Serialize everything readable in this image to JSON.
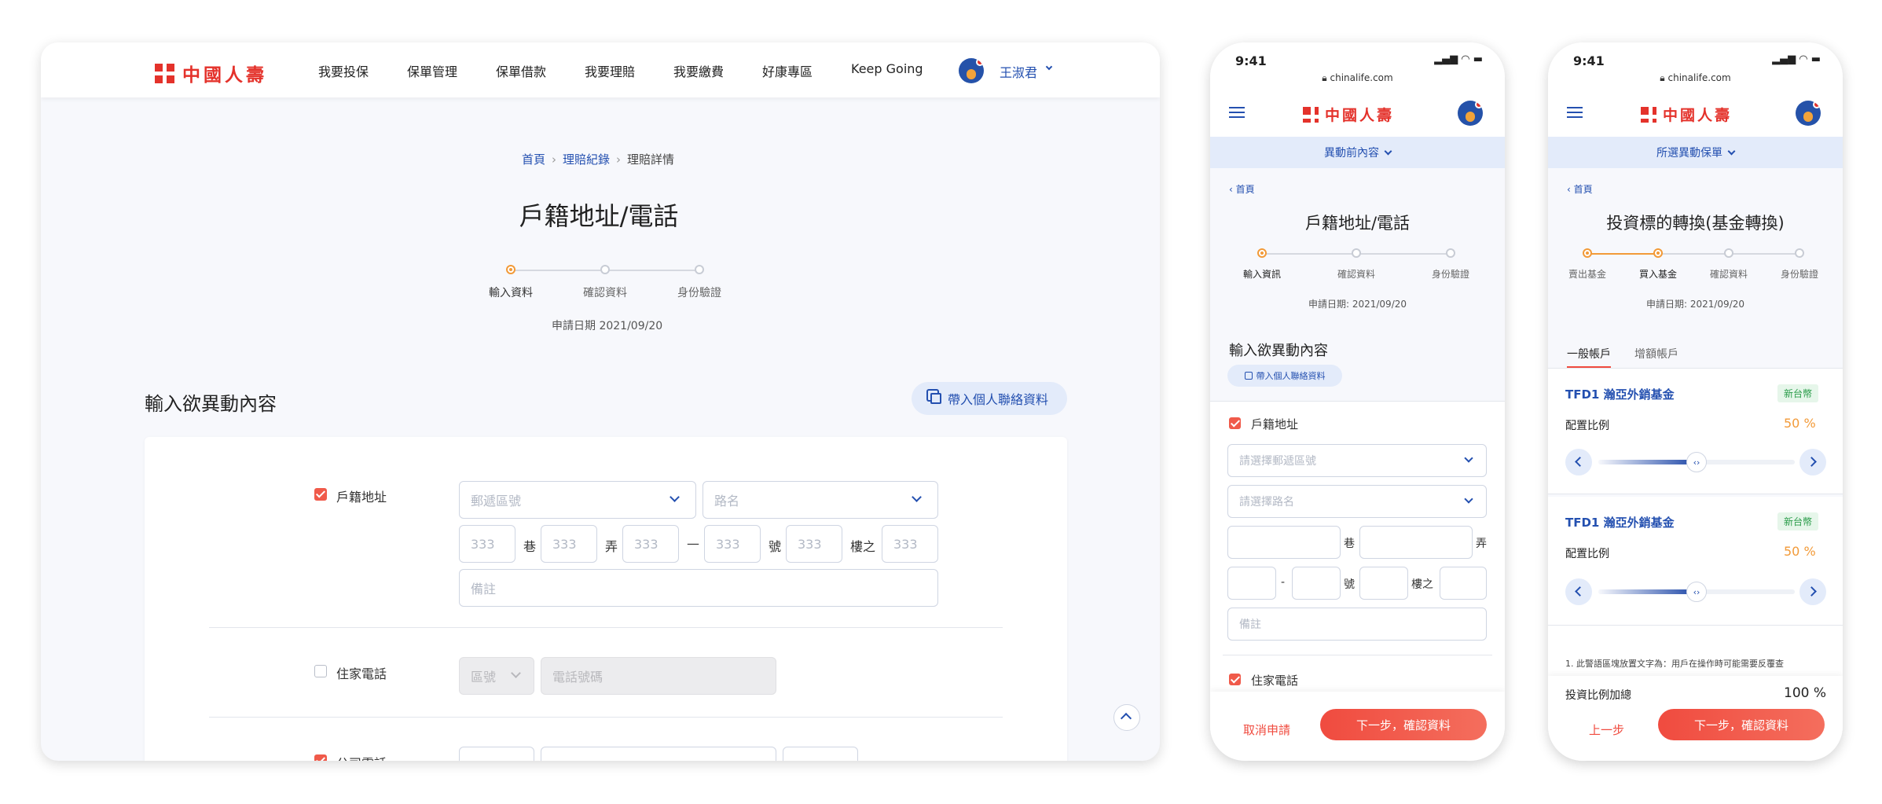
{
  "desktop": {
    "brand": "中國人壽",
    "nav": [
      "我要投保",
      "保單管理",
      "保單借款",
      "我要理賠",
      "我要繳費",
      "好康專區",
      "Keep Going"
    ],
    "user_name": "王淑君",
    "breadcrumb": [
      "首頁",
      "理賠紀錄",
      "理賠詳情"
    ],
    "page_title": "戶籍地址/電話",
    "steps": [
      "輸入資料",
      "確認資料",
      "身份驗證"
    ],
    "apply_date": "申請日期 2021/09/20",
    "section_title": "輸入欲異動內容",
    "import_button": "帶入個人聯絡資料",
    "household_address_label": "戶籍地址",
    "postal_placeholder": "郵遞區號",
    "road_placeholder": "路名",
    "number_placeholder": "333",
    "unit_lane": "巷",
    "unit_alley": "弄",
    "unit_dash": "—",
    "unit_number": "號",
    "unit_floor": "樓之",
    "note_placeholder": "備註",
    "home_phone_label": "住家電話",
    "area_code_placeholder": "區號",
    "phone_placeholder": "電話號碼",
    "office_phone_label": "公司電話"
  },
  "mobile1": {
    "time": "9:41",
    "url": "chinalife.com",
    "brand": "中國人壽",
    "dropdown": "異動前內容",
    "back_link": "首頁",
    "page_title": "戶籍地址/電話",
    "steps": [
      "輸入資訊",
      "確認資料",
      "身份驗證"
    ],
    "apply_date": "申請日期: 2021/09/20",
    "section_title": "輸入欲異動內容",
    "import_button": "帶入個人聯絡資料",
    "household_address_label": "戶籍地址",
    "postal_placeholder": "請選擇郵遞區號",
    "road_placeholder": "請選擇路名",
    "unit_lane": "巷",
    "unit_alley": "弄",
    "unit_dash": "-",
    "unit_number": "號",
    "unit_floor": "樓之",
    "note_placeholder": "備註",
    "home_phone_label": "住家電話",
    "cancel_button": "取消申請",
    "next_button": "下一步，確認資料"
  },
  "mobile2": {
    "time": "9:41",
    "url": "chinalife.com",
    "brand": "中國人壽",
    "dropdown": "所選異動保單",
    "back_link": "首頁",
    "page_title": "投資標的轉換(基金轉換)",
    "steps": [
      "賣出基金",
      "買入基金",
      "確認資料",
      "身份驗證"
    ],
    "apply_date": "申請日期: 2021/09/20",
    "tabs": [
      "一般帳戶",
      "增額帳戶"
    ],
    "funds": [
      {
        "name": "TFD1 瀚亞外銷基金",
        "currency": "新台幣",
        "ratio_label": "配置比例",
        "ratio": "50",
        "unit": "%"
      },
      {
        "name": "TFD1 瀚亞外銷基金",
        "currency": "新台幣",
        "ratio_label": "配置比例",
        "ratio": "50",
        "unit": "%"
      }
    ],
    "notice": "1. 此警語區塊放置文字為：用戶在操作時可能需要反覆查",
    "total_label": "投資比例加總",
    "total_value": "100",
    "total_unit": "%",
    "prev_button": "上一步",
    "next_button": "下一步，確認資料"
  },
  "colors": {
    "brand_red": "#e4322b",
    "primary_blue": "#2450b0",
    "accent_orange": "#f29a38"
  }
}
